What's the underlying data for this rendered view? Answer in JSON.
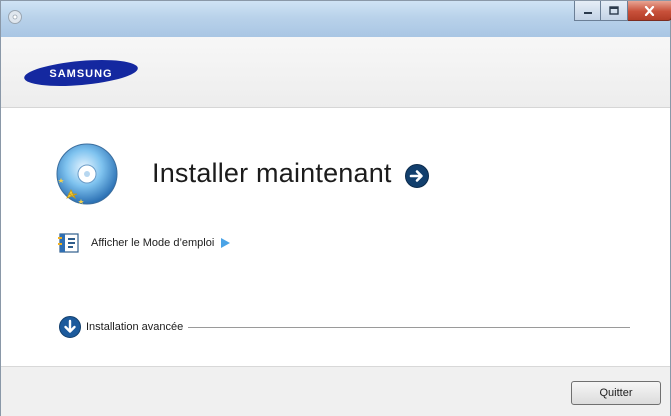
{
  "window": {
    "controls": {
      "minimize": "minimize-icon",
      "maximize": "maximize-icon",
      "close": "close-icon"
    }
  },
  "header": {
    "logo_text": "SAMSUNG",
    "brand_color": "#1428a0"
  },
  "main": {
    "install_now_label": "Installer maintenant",
    "install_icon": "disc-icon",
    "install_arrow_icon": "arrow-right-circle-icon",
    "manual_label": "Afficher le Mode d’emploi",
    "manual_icon": "document-icon",
    "manual_arrow_icon": "play-arrow-icon",
    "advanced_label": "Installation avancée",
    "advanced_icon": "arrow-down-circle-icon"
  },
  "footer": {
    "quit_label": "Quitter"
  }
}
